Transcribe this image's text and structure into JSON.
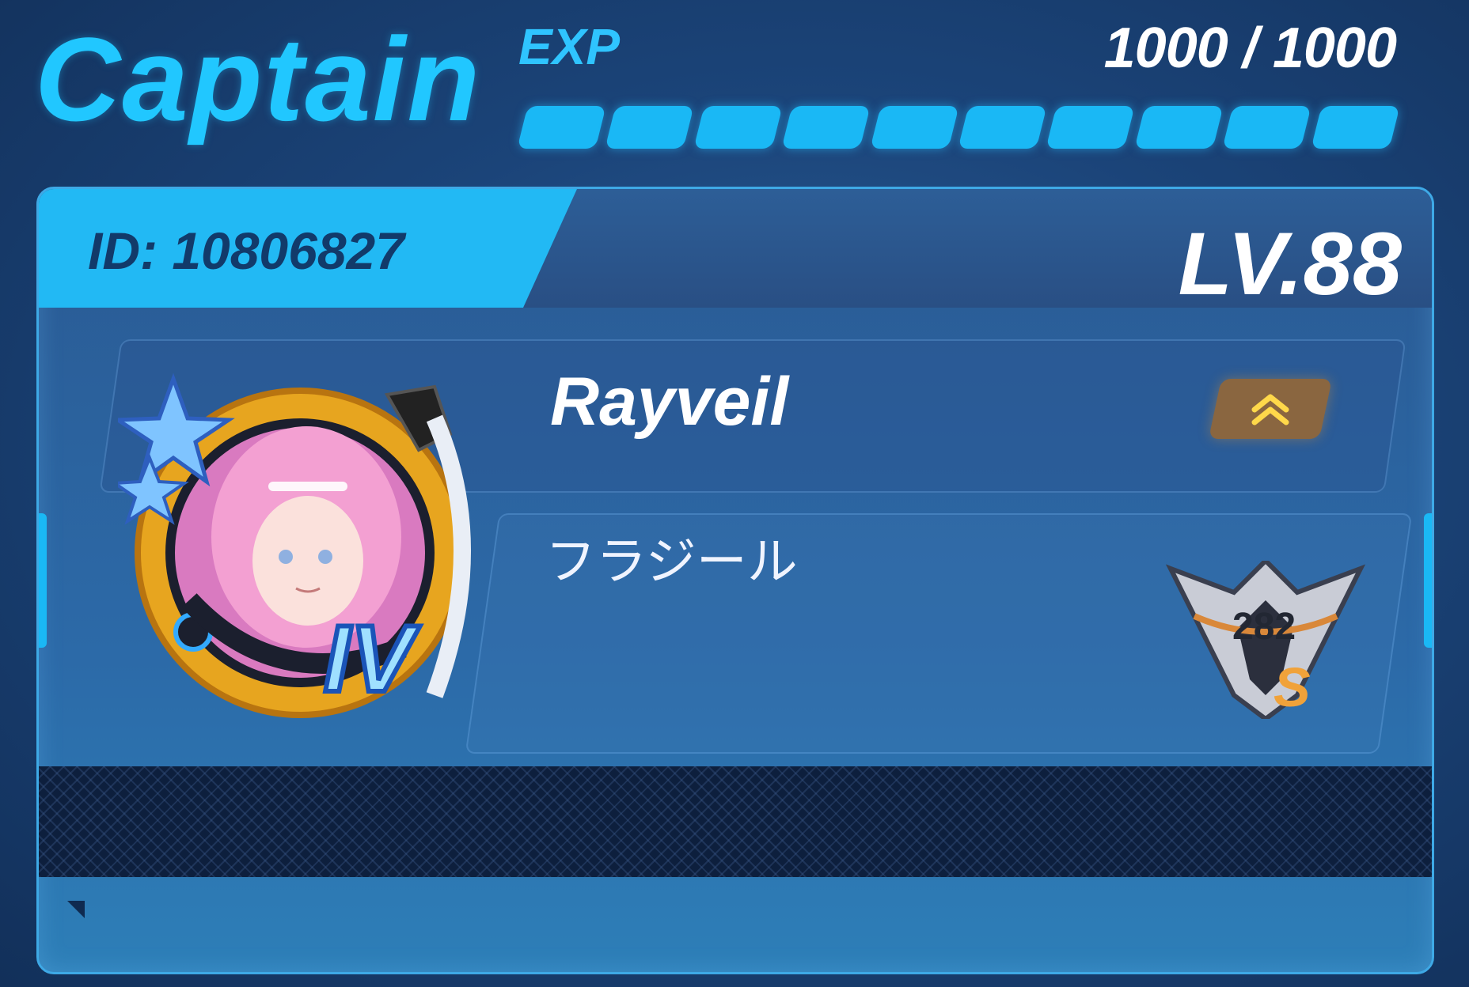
{
  "header": {
    "title": "Captain",
    "exp_label": "EXP",
    "exp_count": "1000 / 1000",
    "exp_progress": 1.0,
    "exp_segments": 10,
    "accent_color": "#21c7ff"
  },
  "card": {
    "id_text": "ID:  10806827",
    "level_text": "LV.88",
    "player_name": "Rayveil",
    "signature": "フラジール",
    "avatar_rank": "IV",
    "badge_number": "282",
    "badge_grade": "S",
    "rank_up_icon": "double-chevron-up-icon",
    "rank_up_color": "#8a6640"
  }
}
